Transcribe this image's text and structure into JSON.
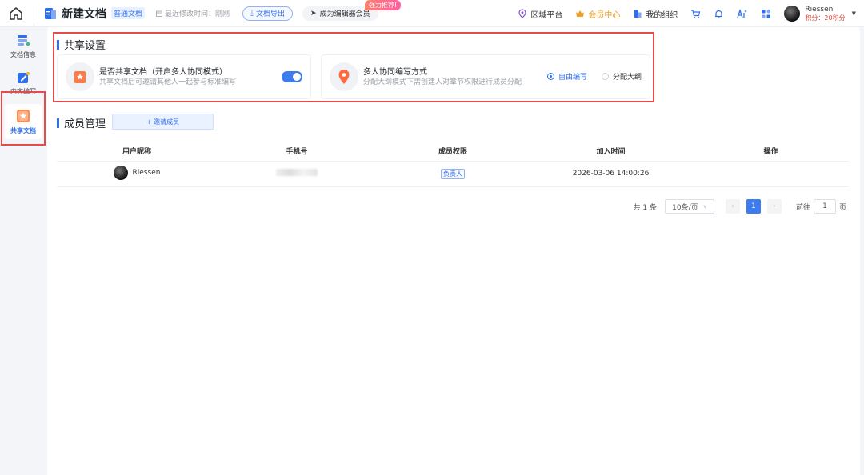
{
  "header": {
    "doc_title": "新建文档",
    "doc_type": "普通文档",
    "last_edit": "最近修改时间：刚刚",
    "export_label": "文档导出",
    "become_member_label": "成为编辑器会员",
    "hot_badge": "强力推荐!",
    "region_platform": "区域平台",
    "member_center": "会员中心",
    "my_org": "我的组织",
    "user_name": "Riessen",
    "user_points": "积分：20积分"
  },
  "sidebar": {
    "items": [
      {
        "label": "文档信息"
      },
      {
        "label": "内容编写"
      },
      {
        "label": "共享文档"
      }
    ]
  },
  "share_settings": {
    "title": "共享设置",
    "share_card": {
      "title": "是否共享文档（开启多人协同模式）",
      "desc": "共享文档后可邀请其他人一起参与标准编写",
      "toggle_on": true
    },
    "collab_card": {
      "title": "多人协同编写方式",
      "desc": "分配大纲模式下需创建人对章节权限进行成员分配",
      "options": [
        "自由编写",
        "分配大纲"
      ],
      "selected": "自由编写"
    }
  },
  "members": {
    "title": "成员管理",
    "invite_label": "+ 邀请成员",
    "columns": [
      "用户昵称",
      "手机号",
      "成员权限",
      "加入时间",
      "操作"
    ],
    "rows": [
      {
        "name": "Riessen",
        "phone": "",
        "role": "负责人",
        "joined": "2026-03-06 14:00:26",
        "action": ""
      }
    ]
  },
  "pagination": {
    "total": "共 1 条",
    "page_size": "10条/页",
    "current_page": "1",
    "goto_prefix": "前往",
    "goto_value": "1",
    "goto_suffix": "页"
  },
  "colors": {
    "accent": "#2f6fed",
    "highlight_border": "#e64a4a",
    "vip": "#f0a020"
  }
}
